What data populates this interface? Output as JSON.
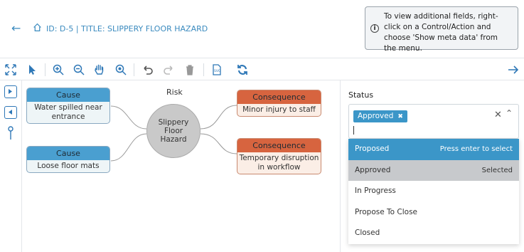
{
  "header": {
    "back_icon": "arrow-left-icon",
    "home_icon": "home-icon",
    "breadcrumb": "ID: D-5 | TITLE: SLIPPERY FLOOR HAZARD"
  },
  "tooltip": {
    "text": "To view additional fields, right-click on a Control/Action and choose 'Show meta data' from the menu.",
    "icon": "info-icon"
  },
  "toolbar": {
    "icons": [
      "fit-icon",
      "pointer-icon",
      "zoom-in-icon",
      "zoom-out-icon",
      "pan-icon",
      "zoom-reset-icon",
      "undo-icon",
      "redo-icon",
      "delete-icon",
      "svg-export-icon",
      "refresh-icon",
      "arrow-right-icon"
    ]
  },
  "diagram": {
    "risk_label": "Risk",
    "risk_text": "Slippery Floor Hazard",
    "causes": [
      {
        "header": "Cause",
        "text": "Water spilled near entrance"
      },
      {
        "header": "Cause",
        "text": "Loose floor mats"
      }
    ],
    "consequences": [
      {
        "header": "Consequence",
        "text": "Minor injury to staff"
      },
      {
        "header": "Consequence",
        "text": "Temporary disruption in workflow"
      }
    ]
  },
  "panel": {
    "status_label": "Status",
    "selected_chip": "Approved",
    "options": [
      {
        "label": "Proposed",
        "hint": "Press enter to select",
        "state": "focused"
      },
      {
        "label": "Approved",
        "hint": "Selected",
        "state": "selected"
      },
      {
        "label": "In Progress",
        "hint": "",
        "state": ""
      },
      {
        "label": "Propose To Close",
        "hint": "",
        "state": ""
      },
      {
        "label": "Closed",
        "hint": "",
        "state": ""
      }
    ]
  },
  "colors": {
    "accent": "#3b96c8",
    "cause_header": "#4a9fd0",
    "consequence_header": "#d7643f",
    "risk_fill": "#c9c9c9"
  }
}
